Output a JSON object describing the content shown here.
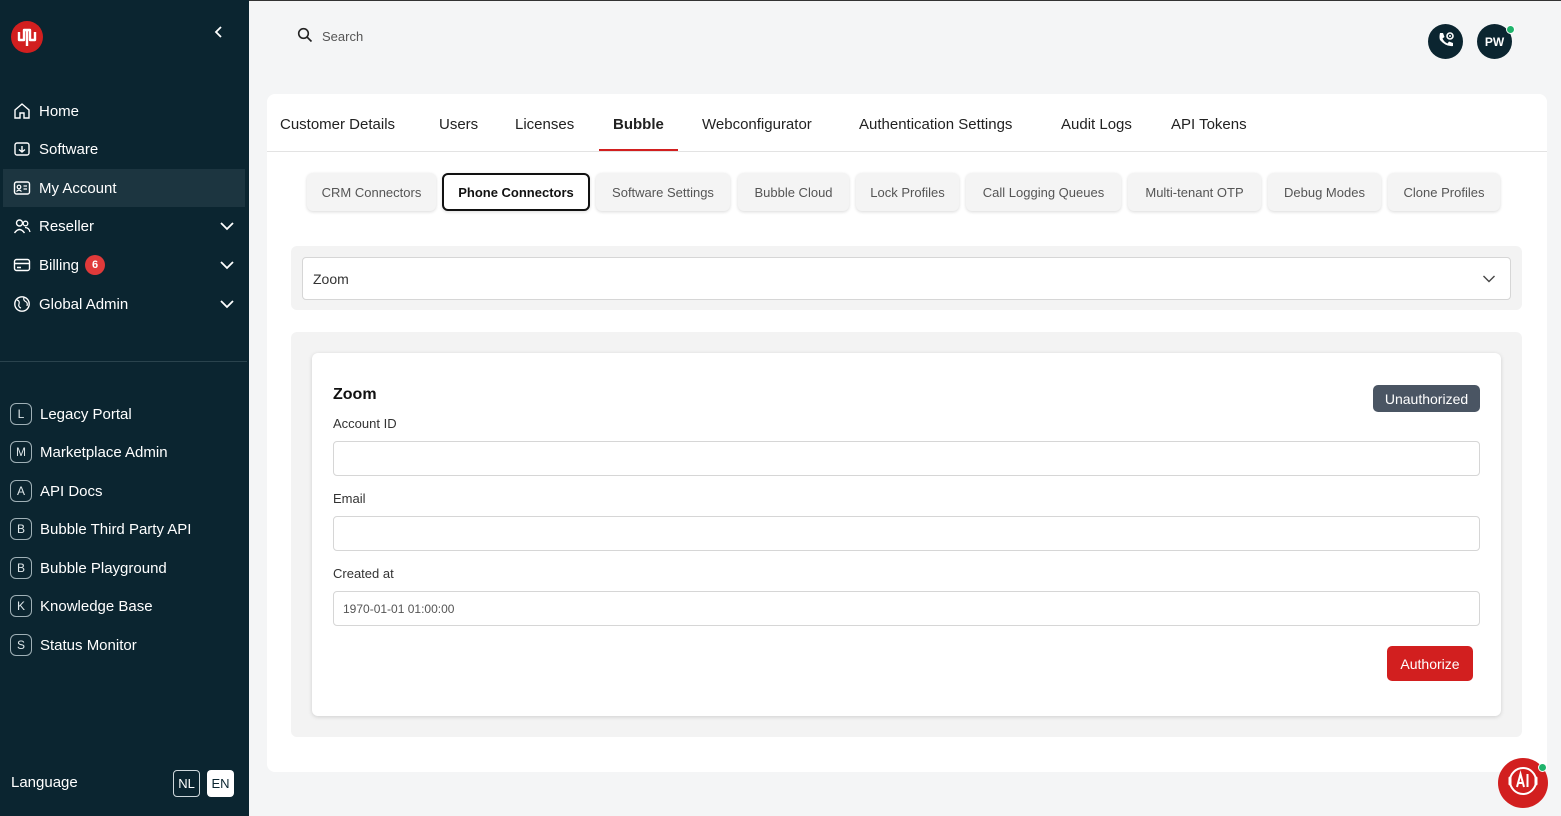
{
  "sidebar": {
    "nav": [
      {
        "label": "Home",
        "icon": "home-icon"
      },
      {
        "label": "Software",
        "icon": "download-icon"
      },
      {
        "label": "My Account",
        "icon": "id-card-icon",
        "active": true
      },
      {
        "label": "Reseller",
        "icon": "users-icon",
        "expandable": true
      },
      {
        "label": "Billing",
        "icon": "credit-card-icon",
        "expandable": true,
        "badge": "6"
      },
      {
        "label": "Global Admin",
        "icon": "globe-icon",
        "expandable": true
      }
    ],
    "links": [
      {
        "letter": "L",
        "label": "Legacy Portal"
      },
      {
        "letter": "M",
        "label": "Marketplace Admin"
      },
      {
        "letter": "A",
        "label": "API Docs"
      },
      {
        "letter": "B",
        "label": "Bubble Third Party API"
      },
      {
        "letter": "B",
        "label": "Bubble Playground"
      },
      {
        "letter": "K",
        "label": "Knowledge Base"
      },
      {
        "letter": "S",
        "label": "Status Monitor"
      }
    ],
    "language": {
      "label": "Language",
      "options": [
        "NL",
        "EN"
      ],
      "selected": "EN"
    }
  },
  "topbar": {
    "search_placeholder": "Search",
    "avatar_initials": "PW"
  },
  "tabs": [
    {
      "label": "Customer Details"
    },
    {
      "label": "Users"
    },
    {
      "label": "Licenses"
    },
    {
      "label": "Bubble",
      "active": true
    },
    {
      "label": "Webconfigurator"
    },
    {
      "label": "Authentication Settings"
    },
    {
      "label": "Audit Logs"
    },
    {
      "label": "API Tokens"
    }
  ],
  "subtabs": [
    {
      "label": "CRM Connectors"
    },
    {
      "label": "Phone Connectors",
      "active": true
    },
    {
      "label": "Software Settings"
    },
    {
      "label": "Bubble Cloud"
    },
    {
      "label": "Lock Profiles"
    },
    {
      "label": "Call Logging Queues"
    },
    {
      "label": "Multi-tenant OTP"
    },
    {
      "label": "Debug Modes"
    },
    {
      "label": "Clone Profiles"
    }
  ],
  "connector_select": {
    "value": "Zoom"
  },
  "connector": {
    "title": "Zoom",
    "status": "Unauthorized",
    "fields": {
      "account_id": {
        "label": "Account ID",
        "value": ""
      },
      "email": {
        "label": "Email",
        "value": ""
      },
      "created_at": {
        "label": "Created at",
        "value": "1970-01-01 01:00:00"
      }
    },
    "authorize_label": "Authorize"
  },
  "colors": {
    "sidebar_bg": "#0b2530",
    "accent_red": "#d21f1f",
    "status_gray": "#4a5563",
    "online_green": "#1fb36b"
  }
}
